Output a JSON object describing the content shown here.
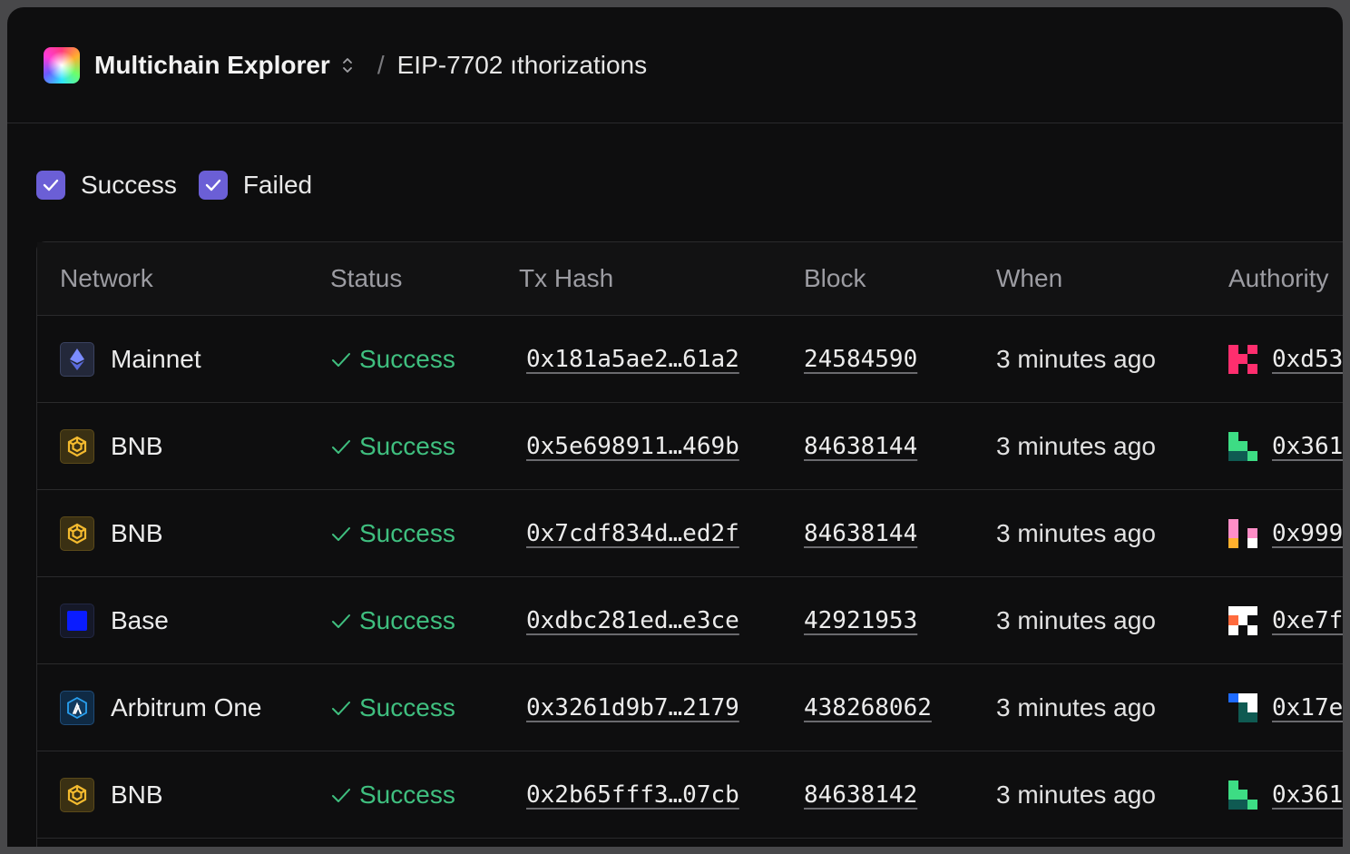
{
  "header": {
    "app_title": "Multichain Explorer",
    "separator": "/",
    "breadcrumb": "EIP-7702 ıthorizations"
  },
  "filters": [
    {
      "label": "Success",
      "checked": true
    },
    {
      "label": "Failed",
      "checked": true
    }
  ],
  "table": {
    "columns": [
      "Network",
      "Status",
      "Tx Hash",
      "Block",
      "When",
      "Authority"
    ],
    "rows": [
      {
        "network": "Mainnet",
        "icon": "ethereum-icon",
        "status": "Success",
        "tx_hash": "0x181a5ae2…61a2",
        "block": "24584590",
        "when": "3 minutes ago",
        "authority": "0xd53",
        "ident_colors": [
          "#ff2e6e",
          "#0e0e0f",
          "#ff2e6e",
          "#ff2e6e",
          "#ff2e6e",
          "#0e0e0f",
          "#ff2e6e",
          "#0e0e0f",
          "#ff2e6e"
        ]
      },
      {
        "network": "BNB",
        "icon": "bnb-icon",
        "status": "Success",
        "tx_hash": "0x5e698911…469b",
        "block": "84638144",
        "when": "3 minutes ago",
        "authority": "0x361",
        "ident_colors": [
          "#3ddc84",
          "#0e0e0f",
          "#0e0e0f",
          "#3ddc84",
          "#3ddc84",
          "#0e0e0f",
          "#0f5a52",
          "#0f5a52",
          "#3ddc84"
        ]
      },
      {
        "network": "BNB",
        "icon": "bnb-icon",
        "status": "Success",
        "tx_hash": "0x7cdf834d…ed2f",
        "block": "84638144",
        "when": "3 minutes ago",
        "authority": "0x999",
        "ident_colors": [
          "#ff8ec7",
          "#0e0e0f",
          "#0e0e0f",
          "#ff8ec7",
          "#0e0e0f",
          "#ff8ec7",
          "#ffb02e",
          "#0e0e0f",
          "#ffffff"
        ]
      },
      {
        "network": "Base",
        "icon": "base-icon",
        "status": "Success",
        "tx_hash": "0xdbc281ed…e3ce",
        "block": "42921953",
        "when": "3 minutes ago",
        "authority": "0xe7f",
        "ident_colors": [
          "#ffffff",
          "#ffffff",
          "#ffffff",
          "#ff6a3d",
          "#ffffff",
          "#0e0e0f",
          "#ffffff",
          "#0e0e0f",
          "#ffffff"
        ]
      },
      {
        "network": "Arbitrum One",
        "icon": "arbitrum-icon",
        "status": "Success",
        "tx_hash": "0x3261d9b7…2179",
        "block": "438268062",
        "when": "3 minutes ago",
        "authority": "0x17e",
        "ident_colors": [
          "#1e6bff",
          "#ffffff",
          "#ffffff",
          "#0e0e0f",
          "#0f5a52",
          "#ffffff",
          "#0e0e0f",
          "#0f5a52",
          "#0f5a52"
        ]
      },
      {
        "network": "BNB",
        "icon": "bnb-icon",
        "status": "Success",
        "tx_hash": "0x2b65fff3…07cb",
        "block": "84638142",
        "when": "3 minutes ago",
        "authority": "0x361",
        "ident_colors": [
          "#3ddc84",
          "#0e0e0f",
          "#0e0e0f",
          "#3ddc84",
          "#3ddc84",
          "#0e0e0f",
          "#0f5a52",
          "#0f5a52",
          "#3ddc84"
        ]
      }
    ]
  },
  "colors": {
    "success": "#3fbf7f",
    "checkbox": "#6b5fd6",
    "background": "#0e0e0f"
  }
}
